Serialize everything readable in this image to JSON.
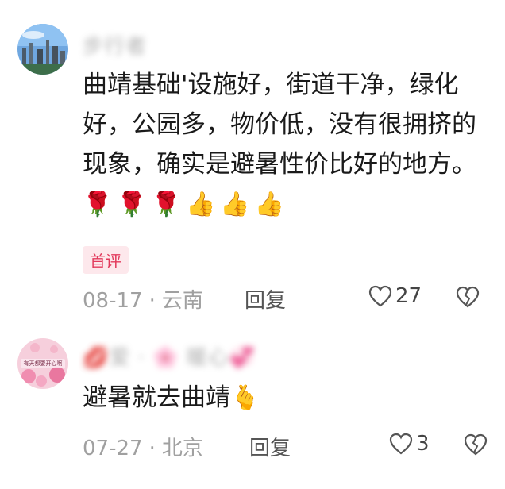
{
  "comments": [
    {
      "username": "步行者",
      "text": "曲靖基础'设施好，街道干净，绿化好，公园多，物价低，没有很拥挤的现象，确实是避暑性价比好的地方。",
      "emojis": "🌹🌹🌹👍👍👍",
      "badge": "首评",
      "date": "08-17",
      "location": "云南",
      "reply_label": "回复",
      "likes": "27",
      "avatar_icon": "city-skyline-avatar"
    },
    {
      "username": "💋爱 · 🌸 暖心💞",
      "text": "避暑就去曲靖",
      "emojis": "🫰",
      "date": "07-27",
      "location": "北京",
      "reply_label": "回复",
      "likes": "3",
      "avatar_icon": "pink-flower-avatar",
      "avatar_text": "有天都要开心啊"
    }
  ],
  "colors": {
    "meta_gray": "#a0a0a0",
    "badge_bg": "#fde8ec",
    "badge_fg": "#e23a5c"
  }
}
